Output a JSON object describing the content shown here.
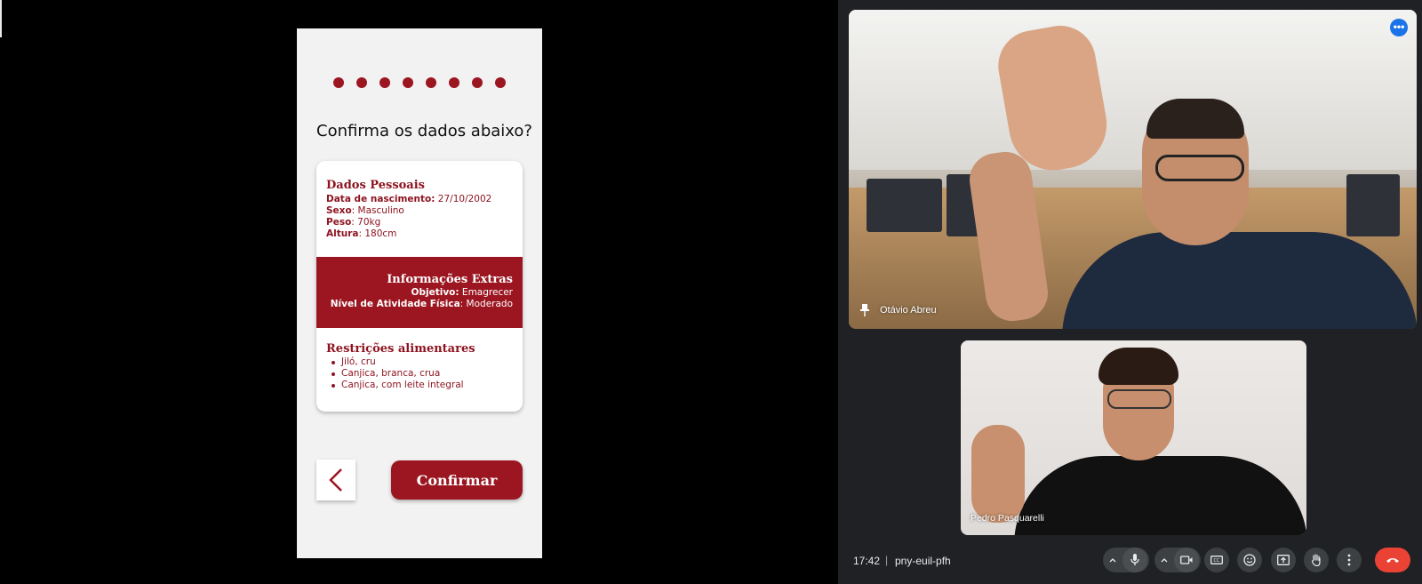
{
  "app": {
    "progress_dots": 8,
    "question": "Confirma os dados abaixo?",
    "personal": {
      "title": "Dados Pessoais",
      "birth_label": "Data de nascimento:",
      "birth_value": " 27/10/2002",
      "sex_label": "Sexo",
      "sex_value": ": Masculino",
      "weight_label": "Peso",
      "weight_value": ": 70kg",
      "height_label": "Altura",
      "height_value": ": 180cm"
    },
    "extras": {
      "title": "Informações Extras",
      "goal_label": "Objetivo:",
      "goal_value": " Emagrecer",
      "activity_label": "Nível de Atividade Física",
      "activity_value": ": Moderado"
    },
    "restrictions": {
      "title": "Restrições alimentares",
      "items": [
        "Jiló, cru",
        "Canjica, branca, crua",
        "Canjica, com leite integral"
      ]
    },
    "confirm_label": "Confirmar",
    "accent_color": "#9b1620"
  },
  "meet": {
    "participants": [
      {
        "name": "Otávio Abreu",
        "pinned": true
      },
      {
        "name": "Pedro Pasquarelli",
        "pinned": false
      }
    ],
    "time": "17:42",
    "separator": "|",
    "meeting_code": "pny-euil-pfh",
    "controls": [
      "mic-icon",
      "camera-icon",
      "captions-icon",
      "emoji-icon",
      "present-icon",
      "raise-hand-icon",
      "more-options-icon",
      "end-call-icon"
    ],
    "end_color": "#ea4335"
  }
}
